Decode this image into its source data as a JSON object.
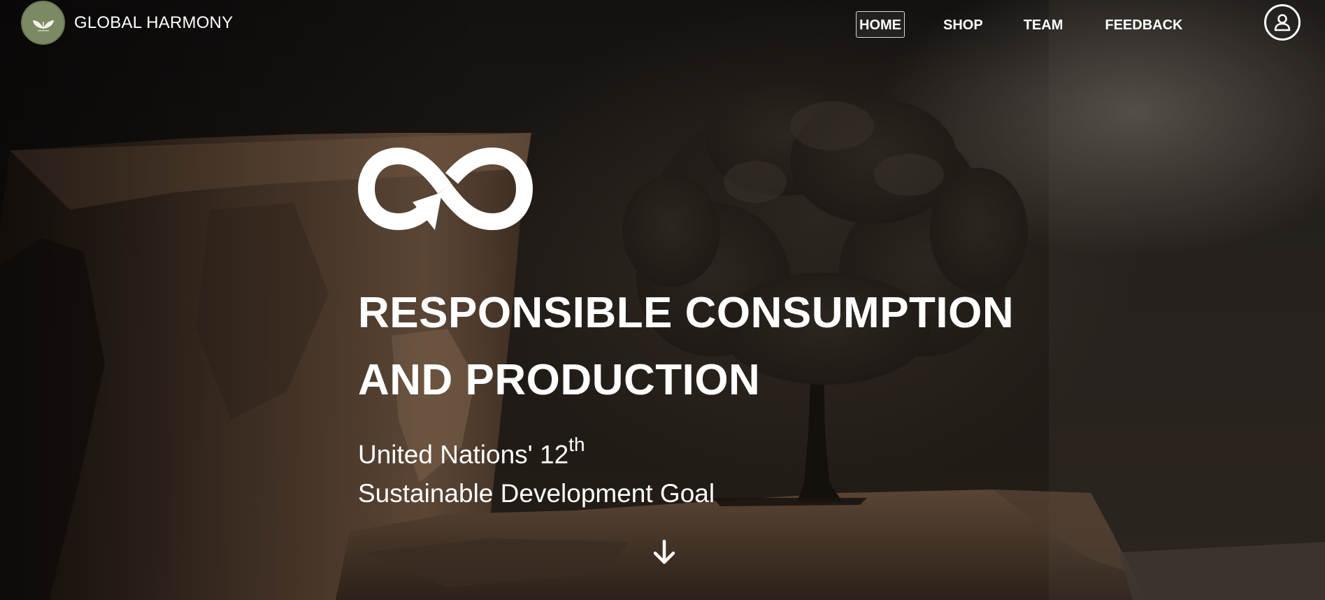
{
  "brand": {
    "name": "GLOBAL HARMONY",
    "logo_icon": "leaf-sprout-icon",
    "logo_color": "#7c8a63"
  },
  "nav": {
    "items": [
      {
        "label": "HOME",
        "active": true
      },
      {
        "label": "SHOP",
        "active": false
      },
      {
        "label": "TEAM",
        "active": false
      },
      {
        "label": "FEEDBACK",
        "active": false
      }
    ],
    "account_icon": "user-account-icon"
  },
  "hero": {
    "icon": "infinity-arrow-icon",
    "title_line1": "RESPONSIBLE CONSUMPTION",
    "title_line2": "AND PRODUCTION",
    "subtitle_line1_main": "United Nations' 12",
    "subtitle_line1_sup": "th",
    "subtitle_line2": "Sustainable Development Goal",
    "scroll_icon": "arrow-down-icon"
  },
  "colors": {
    "text": "#ffffff",
    "background": "#1d1915",
    "accent": "#7c8a63"
  }
}
